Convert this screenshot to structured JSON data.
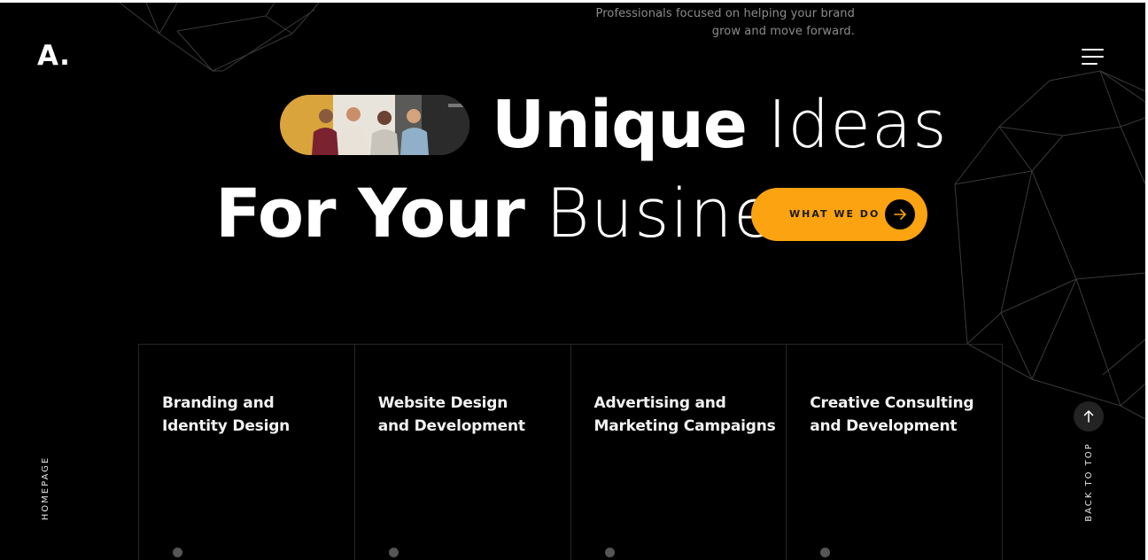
{
  "header": {
    "tagline_line1": "Professionals focused on helping your brand",
    "tagline_line2": "grow and move forward.",
    "logo": "A."
  },
  "hero": {
    "line1_bold": "Unique",
    "line1_light": "Ideas",
    "line2_bold": "For Your",
    "line2_light": "Business.",
    "cta_label": "WHAT WE DO"
  },
  "services": [
    {
      "title": "Branding and\nIdentity Design"
    },
    {
      "title": "Website Design\nand Development"
    },
    {
      "title": "Advertising and\nMarketing Campaigns"
    },
    {
      "title": "Creative Consulting\nand Development"
    }
  ],
  "side": {
    "left_label": "HOMEPAGE",
    "right_label": "BACK TO TOP"
  },
  "colors": {
    "background": "#000000",
    "accent": "#fca311",
    "text": "#ffffff",
    "muted": "#8c8c8c"
  },
  "icons": {
    "menu": "hamburger-menu-icon",
    "cta": "arrow-right-icon",
    "back_to_top": "arrow-up-icon"
  }
}
